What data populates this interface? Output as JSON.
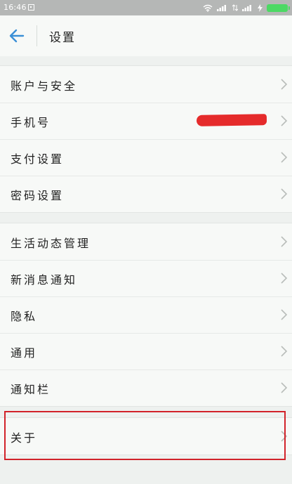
{
  "status_bar": {
    "time": "16:46"
  },
  "header": {
    "title": "设置"
  },
  "groups": [
    {
      "items": [
        {
          "label": "账户与安全"
        },
        {
          "label": "手机号"
        },
        {
          "label": "支付设置"
        },
        {
          "label": "密码设置"
        }
      ]
    },
    {
      "items": [
        {
          "label": "生活动态管理"
        },
        {
          "label": "新消息通知"
        },
        {
          "label": "隐私"
        },
        {
          "label": "通用"
        },
        {
          "label": "通知栏"
        }
      ]
    },
    {
      "items": [
        {
          "label": "关于"
        }
      ]
    }
  ],
  "colors": {
    "accent_back_arrow": "#3a8fd6",
    "highlight_box": "#d2232a",
    "redaction": "#e52b2b",
    "battery": "#4cd964"
  }
}
